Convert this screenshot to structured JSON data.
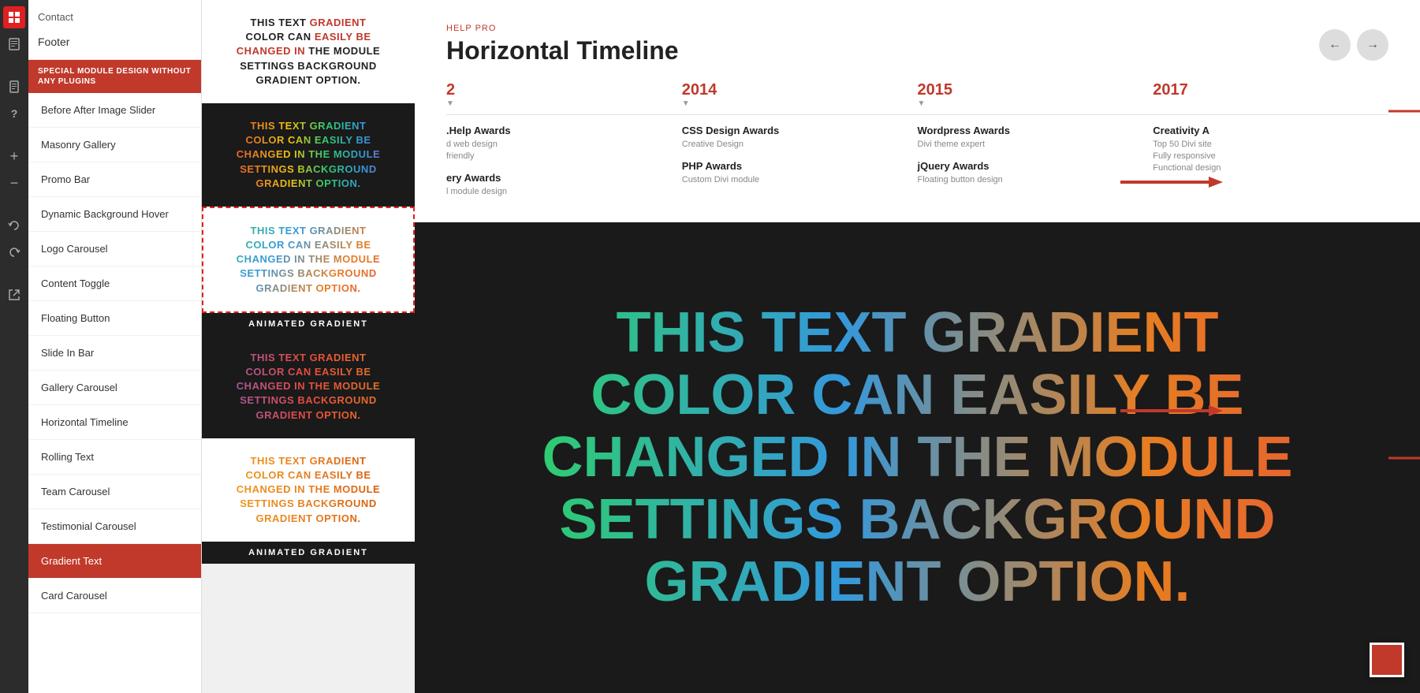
{
  "iconBar": {
    "icons": [
      {
        "name": "grid-icon",
        "symbol": "⊞",
        "active": true
      },
      {
        "name": "page-icon",
        "symbol": "⧉",
        "active": false
      },
      {
        "name": "doc-icon",
        "symbol": "📄",
        "active": false
      },
      {
        "name": "help-icon",
        "symbol": "?",
        "active": false
      },
      {
        "name": "add-icon",
        "symbol": "+",
        "active": false
      },
      {
        "name": "minus-icon",
        "symbol": "−",
        "active": false
      },
      {
        "name": "undo-icon",
        "symbol": "↺",
        "active": false
      },
      {
        "name": "redo-icon",
        "symbol": "↻",
        "active": false
      },
      {
        "name": "external-icon",
        "symbol": "⇱",
        "active": false
      }
    ]
  },
  "sidebar": {
    "contact_label": "Contact",
    "footer_label": "Footer",
    "special_module_label": "SPECIAL MODULE DESIGN\nWITHOUT ANY PLUGINS",
    "items": [
      {
        "label": "Before After Image Slider",
        "active": false
      },
      {
        "label": "Masonry Gallery",
        "active": false
      },
      {
        "label": "Promo Bar",
        "active": false
      },
      {
        "label": "Dynamic Background Hover",
        "active": false
      },
      {
        "label": "Logo Carousel",
        "active": false
      },
      {
        "label": "Content Toggle",
        "active": false
      },
      {
        "label": "Floating Button",
        "active": false
      },
      {
        "label": "Slide In Bar",
        "active": false
      },
      {
        "label": "Gallery Carousel",
        "active": false
      },
      {
        "label": "Horizontal Timeline",
        "active": false
      },
      {
        "label": "Rolling Text",
        "active": false
      },
      {
        "label": "Team Carousel",
        "active": false
      },
      {
        "label": "Testimonial Carousel",
        "active": false
      },
      {
        "label": "Gradient Text",
        "active": true
      },
      {
        "label": "Card Carousel",
        "active": false
      }
    ]
  },
  "gradientCards": [
    {
      "id": "card1",
      "bg": "white",
      "text": "THIS TEXT GRADIENT COLOR CAN EASILY BE CHANGED IN THE MODULE SETTINGS BACKGROUND GRADIENT OPTION.",
      "textStyle": "red-bold"
    },
    {
      "id": "card2",
      "bg": "dark",
      "text": "THIS TEXT GRADIENT COLOR CAN EASILY BE CHANGED IN THE MODULE SETTINGS BACKGROUND GRADIENT OPTION.",
      "textStyle": "multi-gradient"
    },
    {
      "id": "card3",
      "bg": "white-dashed",
      "text": "THIS TEXT GRADIENT COLOR CAN EASILY BE CHANGED IN THE MODULE SETTINGS BACKGROUND GRADIENT OPTION.",
      "textStyle": "teal-orange",
      "label": "ANIMATED GRADIENT"
    },
    {
      "id": "card4",
      "bg": "dark",
      "text": "THIS TEXT GRADIENT COLOR CAN EASILY BE CHANGED IN THE MODULE SETTINGS BACKGROUND GRADIENT OPTION.",
      "textStyle": "purple-gradient"
    },
    {
      "id": "card5",
      "bg": "white",
      "text": "THIS TEXT GRADIENT COLOR CAN EASILY BE CHANGED IN THE MODULE SETTINGS BACKGROUND GRADIENT OPTION.",
      "textStyle": "gold-gradient",
      "label": "ANIMATED GRADIENT"
    }
  ],
  "timeline": {
    "subtitle": "HELP PRO",
    "title": "Horizontal Timeline",
    "nav": {
      "prev": "←",
      "next": "→"
    },
    "years": [
      "2",
      "2014",
      "2015",
      "2017"
    ],
    "columns": [
      {
        "year": "2",
        "awards": [
          {
            "title": ".Help Awards",
            "details": [
              "d web design",
              "friendly"
            ]
          },
          {
            "title": "ery Awards",
            "details": [
              "l module design"
            ]
          }
        ]
      },
      {
        "year": "2014",
        "awards": [
          {
            "title": "CSS Design Awards",
            "details": [
              "Creative Design"
            ]
          },
          {
            "title": "PHP Awards",
            "details": [
              "Custom Divi module"
            ]
          }
        ]
      },
      {
        "year": "2015",
        "awards": [
          {
            "title": "Wordpress Awards",
            "details": [
              "Divi theme expert"
            ]
          },
          {
            "title": "jQuery Awards",
            "details": [
              "Floating button design"
            ]
          }
        ]
      },
      {
        "year": "2017",
        "awards": [
          {
            "title": "Creativity A",
            "details": [
              "Top 50 Divi site",
              "Fully responsive",
              "Functional design"
            ]
          },
          {
            "title": "",
            "details": []
          }
        ]
      }
    ]
  },
  "largeGradientText": "THIS TEXT GRADIENT COLOR CAN EASILY BE CHANGED IN THE MODULE SETTINGS BACKGROUND GRADIENT OPTION.",
  "colors": {
    "primary_red": "#c0392b",
    "dark_bg": "#1a1a1a",
    "sidebar_active": "#c0392b"
  },
  "arrows": {
    "right_arrow": "→"
  }
}
